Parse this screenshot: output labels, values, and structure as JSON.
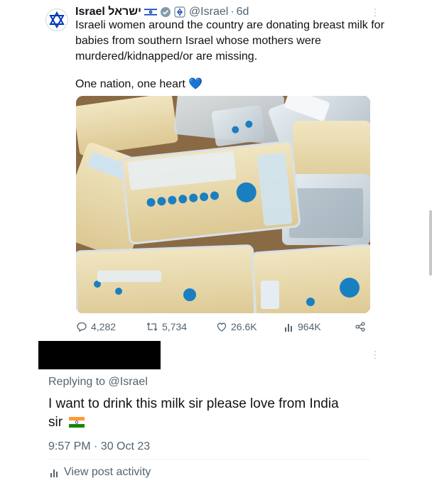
{
  "tweet": {
    "display_name": "Israel ישראל",
    "handle": "@Israel",
    "separator": "·",
    "time_ago": "6d",
    "text": "Israeli women around the country are donating breast milk for babies from southern Israel whose mothers were murdered/kidnapped/or are missing.",
    "text2": "One nation, one heart",
    "heart_emoji": "💙"
  },
  "actions": {
    "replies": "4,282",
    "retweets": "5,734",
    "likes": "26.6K",
    "views": "964K"
  },
  "reply": {
    "replying_label": "Replying to",
    "replying_handle": "@Israel",
    "text_line1": "I want to drink this milk sir please love from India",
    "text_line2": "sir",
    "timestamp": "9:57 PM · 30 Oct 23",
    "activity_label": "View post activity"
  },
  "colors": {
    "accent": "#1d9bf0",
    "muted_text": "#536471",
    "verified_gray": "#829aab"
  },
  "icons": {
    "avatar": "star-of-david-icon",
    "verified": "verified-badge-icon",
    "affiliate": "government-badge-icon",
    "reply": "reply-icon",
    "retweet": "retweet-icon",
    "like": "heart-icon",
    "views": "views-chart-icon",
    "share": "share-icon",
    "flag_israel": "israel-flag-icon",
    "flag_india": "india-flag-icon"
  }
}
